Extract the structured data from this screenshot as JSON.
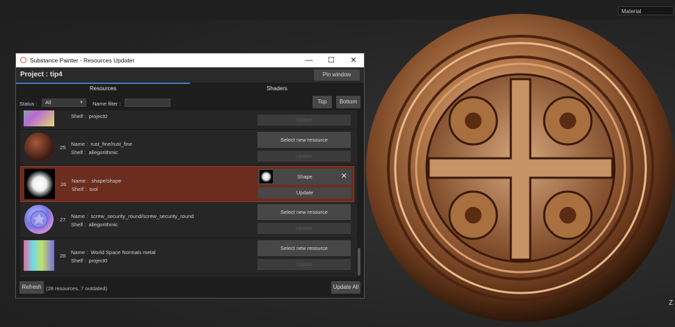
{
  "viewport": {
    "material_dropdown": "Material",
    "zoom_label": "Z"
  },
  "window": {
    "title": "Substance Painter - Resources Updater",
    "controls": {
      "minimize": "—",
      "maximize": "☐",
      "close": "✕"
    },
    "project_title": "Project : tip4",
    "pin_window_label": "Pin window",
    "tabs": [
      {
        "label": "Resources",
        "active": true
      },
      {
        "label": "Shaders",
        "active": false
      }
    ],
    "filters": {
      "status_label": "Status :",
      "status_value": "All",
      "name_filter_label": "Name filter :",
      "name_filter_value": "",
      "top_label": "Top",
      "bottom_label": "Bottom"
    },
    "resources": [
      {
        "index": "",
        "name_label": "",
        "name": "",
        "shelf_label": "Shelf :",
        "shelf": "project0",
        "thumb_icon": "rainbow-normal-map-icon",
        "primary_action": "",
        "secondary_action": "Update",
        "selected": false
      },
      {
        "index": "25",
        "name_label": "Name :",
        "name": "rust_fine/rust_fine",
        "shelf_label": "Shelf :",
        "shelf": "allegorithmic",
        "thumb_icon": "rust-material-sphere-icon",
        "primary_action": "Select new resource",
        "secondary_action": "Update",
        "selected": false
      },
      {
        "index": "26",
        "name_label": "Name :",
        "name": "shape/shape",
        "shelf_label": "Shelf :",
        "shelf": "tool",
        "thumb_icon": "soft-brush-shape-icon",
        "primary_action": "Shape",
        "secondary_action": "Update",
        "selected": true
      },
      {
        "index": "27",
        "name_label": "Name :",
        "name": "screw_security_round/screw_security_round",
        "shelf_label": "Shelf :",
        "shelf": "allegorithmic",
        "thumb_icon": "screw-normal-sphere-icon",
        "primary_action": "Select new resource",
        "secondary_action": "Update",
        "selected": false
      },
      {
        "index": "28",
        "name_label": "Name :",
        "name": "World Space Normals metal",
        "shelf_label": "Shelf :",
        "shelf": "project0",
        "thumb_icon": "world-space-normals-icon",
        "primary_action": "Select new resource",
        "secondary_action": "Update",
        "selected": false
      }
    ],
    "footer": {
      "refresh_label": "Refresh",
      "status_text": "(28 resources, 7 outdated)",
      "update_all_label": "Update All"
    }
  },
  "colors": {
    "accent_tab": "#3d7ec4",
    "selected_row": "#6c2d1f",
    "app_icon": "#d94a3c"
  }
}
